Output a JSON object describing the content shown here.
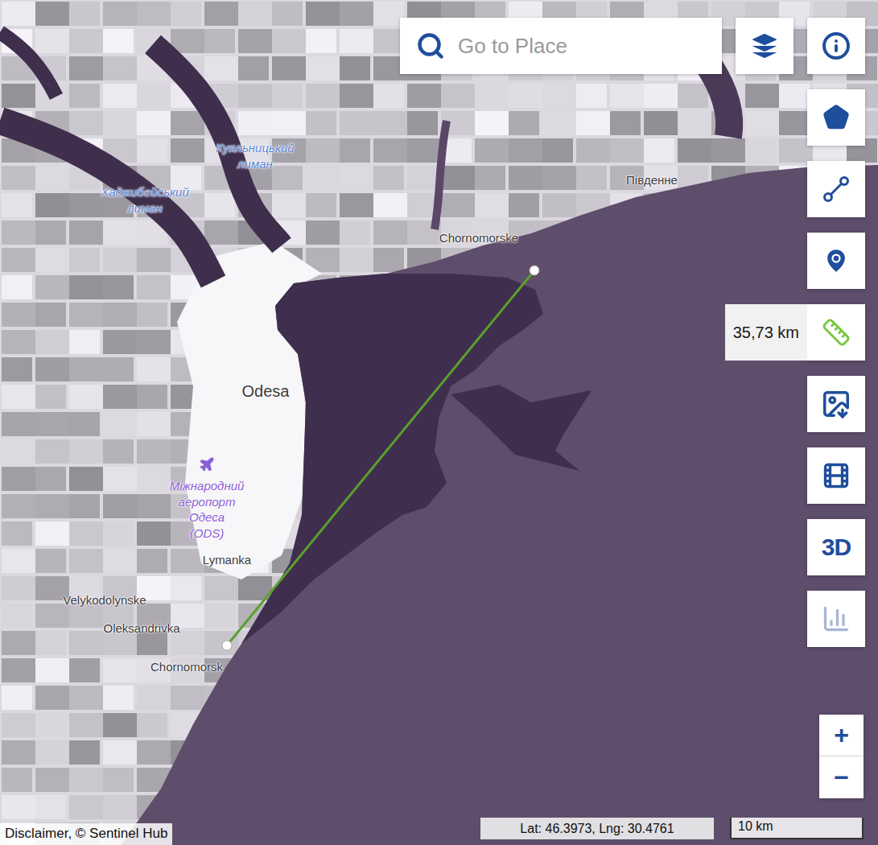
{
  "search": {
    "placeholder": "Go to Place"
  },
  "map_labels": [
    {
      "kind": "water",
      "lines": [
        "Куяльницький",
        "лиман"
      ]
    },
    {
      "kind": "water",
      "lines": [
        "Хаджибейський",
        "лиман"
      ]
    },
    {
      "kind": "place",
      "lines": [
        "Південне"
      ]
    },
    {
      "kind": "place",
      "lines": [
        "Chornomorske"
      ]
    },
    {
      "kind": "city",
      "lines": [
        "Odesa"
      ]
    },
    {
      "kind": "airport",
      "lines": [
        "Міжнародний",
        "аеропорт",
        "Одеса",
        "(ODS)"
      ]
    },
    {
      "kind": "place",
      "lines": [
        "Lymanka"
      ]
    },
    {
      "kind": "place",
      "lines": [
        "Velykodolynske"
      ]
    },
    {
      "kind": "place",
      "lines": [
        "Oleksandrivka"
      ]
    },
    {
      "kind": "place",
      "lines": [
        "Chornomorsk"
      ]
    }
  ],
  "toolbar": [
    {
      "kind": "info",
      "active": false,
      "disabled": false
    },
    {
      "kind": "polygon",
      "active": false,
      "disabled": false
    },
    {
      "kind": "line",
      "active": false,
      "disabled": false
    },
    {
      "kind": "pin",
      "active": false,
      "disabled": false
    },
    {
      "kind": "ruler",
      "active": true,
      "disabled": false
    },
    {
      "kind": "download",
      "active": false,
      "disabled": false
    },
    {
      "kind": "video",
      "active": false,
      "disabled": false
    },
    {
      "kind": "3d",
      "label": "3D",
      "active": false,
      "disabled": false
    },
    {
      "kind": "chart",
      "active": false,
      "disabled": true
    }
  ],
  "measure": {
    "distance": "35,73 km"
  },
  "zoom": {
    "in": "+",
    "out": "−"
  },
  "status_bar": {
    "disclaimer": "Disclaimer, © Sentinel Hub",
    "coordinates": "Lat: 46.3973, Lng: 30.4761",
    "scale": "10 km"
  }
}
